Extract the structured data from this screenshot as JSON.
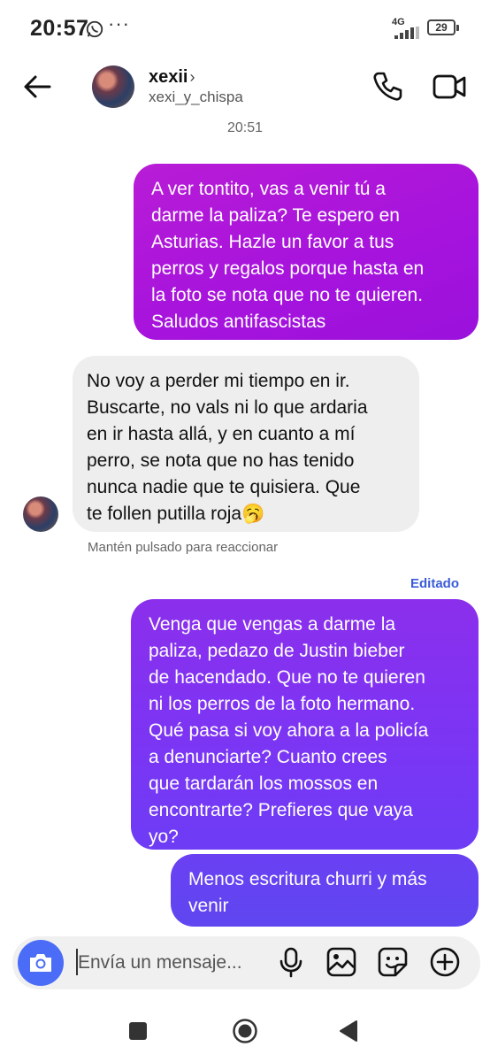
{
  "status_bar": {
    "time": "20:57",
    "more": "···",
    "network": "4G",
    "battery": "29"
  },
  "header": {
    "name": "xexii",
    "chevron": "›",
    "username": "xexi_y_chispa"
  },
  "timestamp": "20:51",
  "messages": [
    {
      "direction": "outgoing",
      "text": "A ver tontito, vas a venir tú a\ndarme la paliza? Te espero en\nAsturias. Hazle un favor a tus\nperros y regalos porque hasta en\nla foto se nota que no te quieren.\nSaludos antifascistas"
    },
    {
      "direction": "incoming",
      "text": "No voy a perder mi tiempo en ir.\nBuscarte, no vals ni lo que ardaria\nen ir hasta allá, y en cuanto a mí\nperro, se nota que no has tenido\nnunca nadie que te quisiera. Que\nte follen putilla roja🥱"
    },
    {
      "direction": "outgoing",
      "text": "Venga que vengas a darme la\npaliza, pedazo de Justin bieber\nde hacendado. Que no te quieren\nni los perros de la foto hermano.\nQué pasa si voy ahora a la policía\na denunciarte? Cuanto crees\nque tardarán los mossos en\nencontrarte? Prefieres que vaya\nyo?"
    },
    {
      "direction": "outgoing",
      "text": "Menos escritura churri y más\nvenir"
    }
  ],
  "react_hint": "Mantén pulsado para reaccionar",
  "edited_label": "Editado",
  "composer": {
    "placeholder": "Envía un mensaje..."
  },
  "icons": {
    "back": "back-arrow-icon",
    "call": "phone-icon",
    "video": "video-camera-icon",
    "camera": "camera-icon",
    "mic": "microphone-icon",
    "gallery": "image-gallery-icon",
    "sticker": "sticker-icon",
    "plus": "plus-circle-icon"
  },
  "colors": {
    "outgoing_magenta": "#a613dd",
    "outgoing_violet": "#7d34f3",
    "outgoing_indigo": "#5f47f0",
    "incoming_bg": "#eeeeee",
    "camera_button": "#4a6cf7",
    "edited_link": "#3a5bd9"
  }
}
